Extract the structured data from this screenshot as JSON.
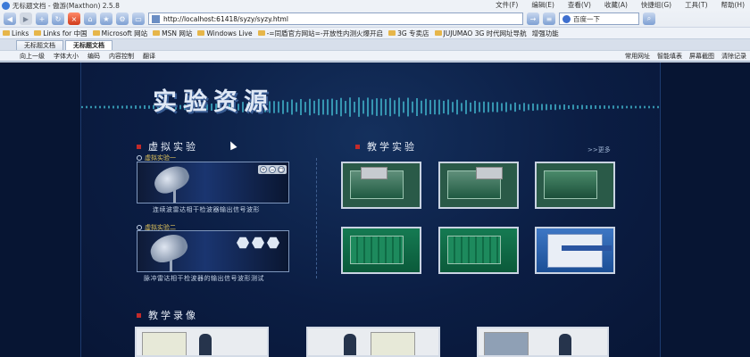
{
  "browser": {
    "window_title": "无标题文档 - 傲游(Maxthon) 2.5.8",
    "menus": [
      "文件(F)",
      "编辑(E)",
      "查看(V)",
      "收藏(A)",
      "快捷组(G)",
      "工具(T)",
      "帮助(H)"
    ],
    "url": "http://localhost:61418/syzy/syzy.html",
    "search_placeholder": "百度一下",
    "links": [
      "Links",
      "Links for 中国",
      "Microsoft 网站",
      "MSN 网站",
      "Windows Live",
      "-=同盾官方网站=-开放性内测火爆开启",
      "3G 专卖店",
      "JUJUMAO 3G 时代网址导航"
    ],
    "extras": [
      "增强功能"
    ],
    "tabs": [
      {
        "label": "无标题文档",
        "active": false
      },
      {
        "label": "无标题文档",
        "active": true
      }
    ],
    "subbar_left": [
      "向上一级",
      "字体大小",
      "编码",
      "内容控制",
      "翻译"
    ],
    "subbar_right": [
      "常用网址",
      "智能填表",
      "屏幕截图",
      "清除记录"
    ]
  },
  "page": {
    "title": "实验资源",
    "virtual": {
      "heading": "虚拟实验",
      "items": [
        {
          "label": "虚拟实验一",
          "caption": "连续波雷达相干检波器输出信号波形"
        },
        {
          "label": "虚拟实验二",
          "caption": "脉冲雷达相干检波器的输出信号波形测试"
        }
      ]
    },
    "teaching": {
      "heading": "教学实验",
      "more": ">>更多"
    },
    "video": {
      "heading": "教学录像"
    }
  },
  "colors": {
    "page_bg": "#0a1a3e",
    "accent_red": "#c32a2a",
    "label_gold": "#e0c35b"
  }
}
